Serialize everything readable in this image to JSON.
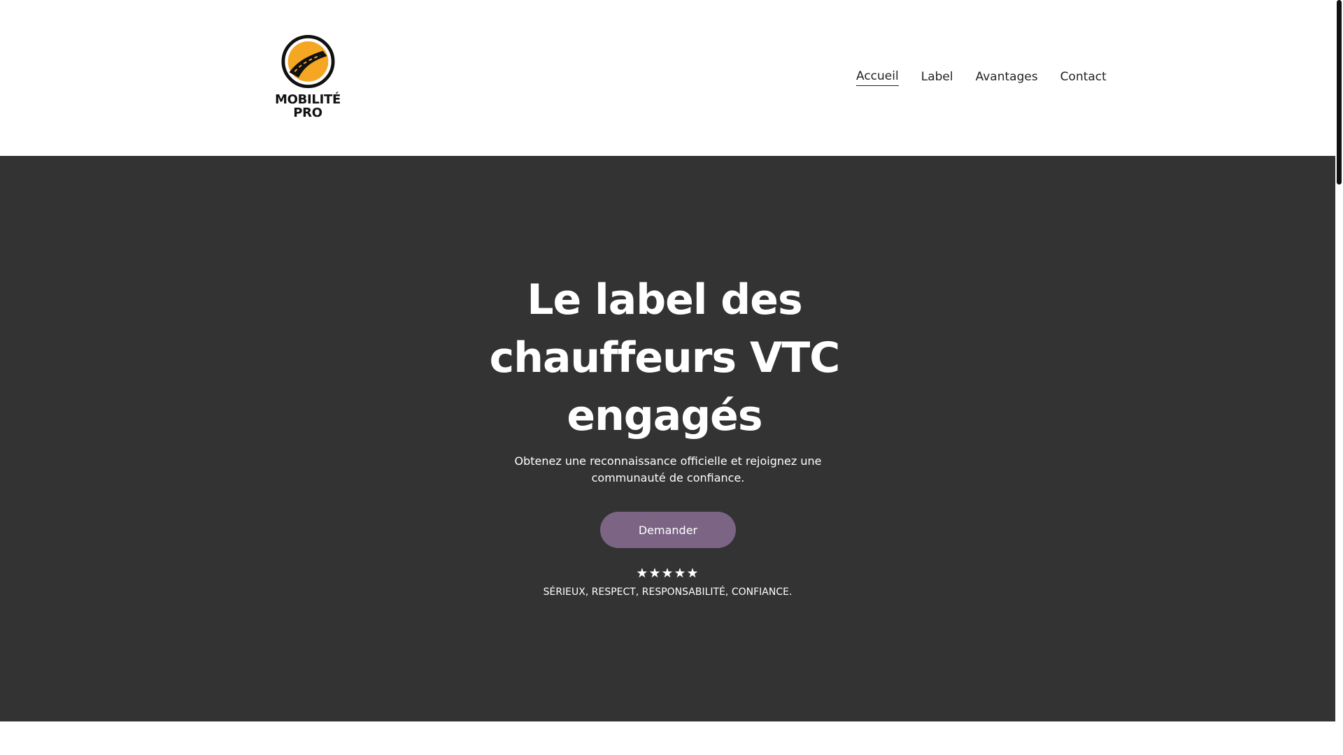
{
  "brand": {
    "line1": "MOBILITÉ",
    "line2": "PRO",
    "colors": {
      "accent": "#f5a623",
      "dark": "#111111"
    }
  },
  "nav": {
    "items": [
      {
        "label": "Accueil",
        "active": true
      },
      {
        "label": "Label",
        "active": false
      },
      {
        "label": "Avantages",
        "active": false
      },
      {
        "label": "Contact",
        "active": false
      }
    ]
  },
  "hero": {
    "title": "Le label des chauffeurs VTC engagés",
    "subtitle": "Obtenez une reconnaissance officielle et rejoignez une communauté de confiance.",
    "cta_label": "Demander",
    "rating": 5,
    "stars": "★★★★★",
    "tagline": "SÉRIEUX, RESPECT, RESPONSABILITÉ, CONFIANCE.",
    "colors": {
      "background": "#333333",
      "button": "#7b6484",
      "text": "#ffffff"
    }
  }
}
